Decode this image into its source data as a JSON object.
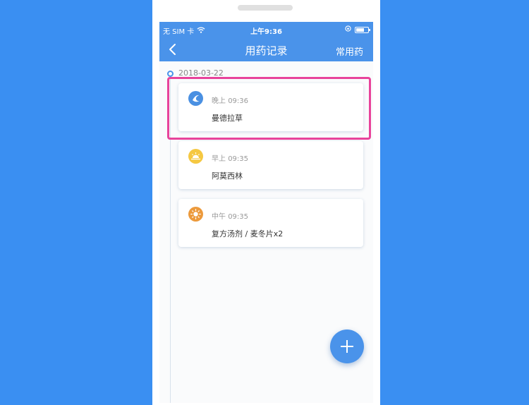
{
  "status_bar": {
    "carrier": "无 SIM 卡",
    "time": "上午9:36"
  },
  "nav": {
    "title": "用药记录",
    "right_action": "常用药"
  },
  "timeline": {
    "date": "2018-03-22",
    "entries": [
      {
        "period": "晚上",
        "time": "09:36",
        "medicine": "曼德拉草",
        "icon": "moon-icon",
        "color": "#4a90e2"
      },
      {
        "period": "早上",
        "time": "09:35",
        "medicine": "阿莫西林",
        "icon": "sunrise-icon",
        "color": "#f5c842"
      },
      {
        "period": "中午",
        "time": "09:35",
        "medicine": "复方汤剂  / 麦冬片x2",
        "icon": "sun-icon",
        "color": "#ec9a3c"
      }
    ]
  },
  "colors": {
    "background": "#3a8ff2",
    "primary": "#4a93ea",
    "highlight": "#e8439b"
  }
}
